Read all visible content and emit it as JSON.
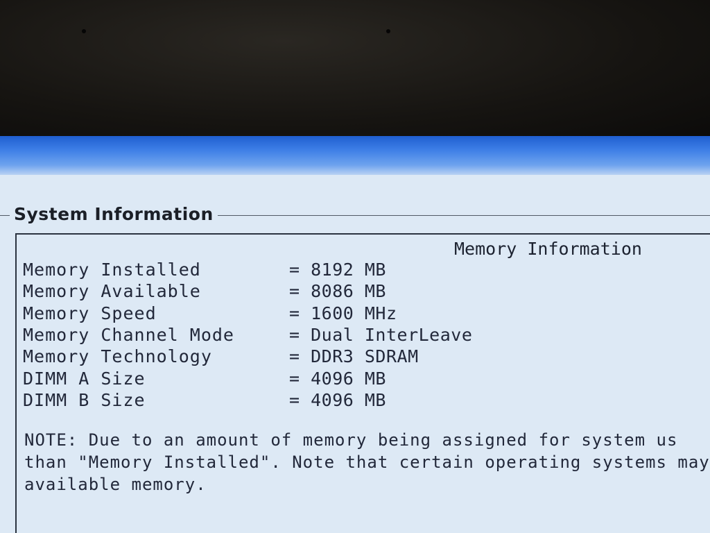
{
  "panel": {
    "title": "System Information"
  },
  "memory": {
    "heading": "Memory Information",
    "rows": [
      {
        "label": "Memory Installed",
        "value": "= 8192 MB"
      },
      {
        "label": "Memory Available",
        "value": "= 8086 MB"
      },
      {
        "label": "Memory Speed",
        "value": "= 1600 MHz"
      },
      {
        "label": "Memory Channel Mode",
        "value": "= Dual InterLeave"
      },
      {
        "label": "Memory Technology",
        "value": "= DDR3 SDRAM"
      },
      {
        "label": "DIMM A Size",
        "value": "= 4096 MB"
      },
      {
        "label": "DIMM B Size",
        "value": "= 4096 MB"
      }
    ],
    "note_lines": [
      "NOTE: Due to an amount of memory being assigned for system us",
      "than \"Memory Installed\". Note that certain operating systems may",
      "available memory."
    ]
  },
  "colors": {
    "screen_background": "#dde9f5",
    "title_bar_blue": "#2f6fe0",
    "text": "#22283a"
  }
}
